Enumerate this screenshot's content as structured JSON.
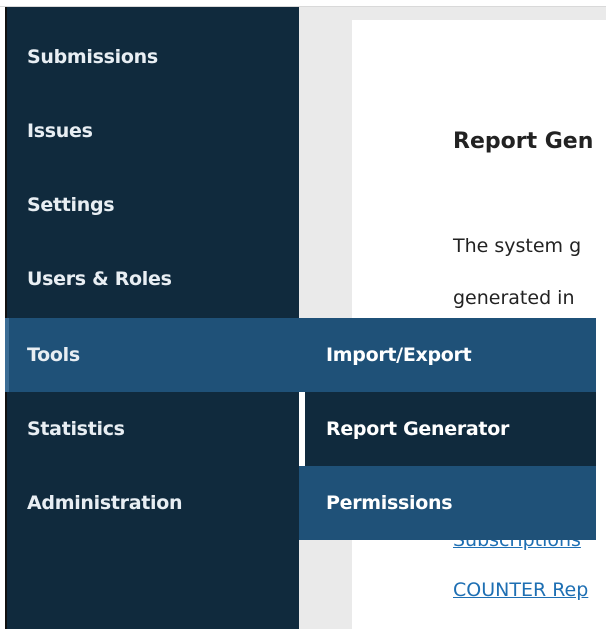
{
  "colors": {
    "sidebar_bg": "#102a3d",
    "active_bg": "#1f5178",
    "link": "#1e6fb3",
    "content_bg": "#eaeaea"
  },
  "sidebar": {
    "items": [
      {
        "label": "Submissions"
      },
      {
        "label": "Issues"
      },
      {
        "label": "Settings"
      },
      {
        "label": "Users & Roles"
      },
      {
        "label": "Tools",
        "active": true
      },
      {
        "label": "Statistics"
      },
      {
        "label": "Administration"
      }
    ]
  },
  "submenu": {
    "items": [
      {
        "label": "Import/Export"
      },
      {
        "label": "Report Generator",
        "current": true
      },
      {
        "label": "Permissions"
      }
    ]
  },
  "main": {
    "title": "Report Gen",
    "text_line_1": "The system g",
    "text_line_2": "generated in",
    "links": [
      {
        "label": "Subscriptions"
      },
      {
        "label": "COUNTER Rep"
      }
    ]
  }
}
